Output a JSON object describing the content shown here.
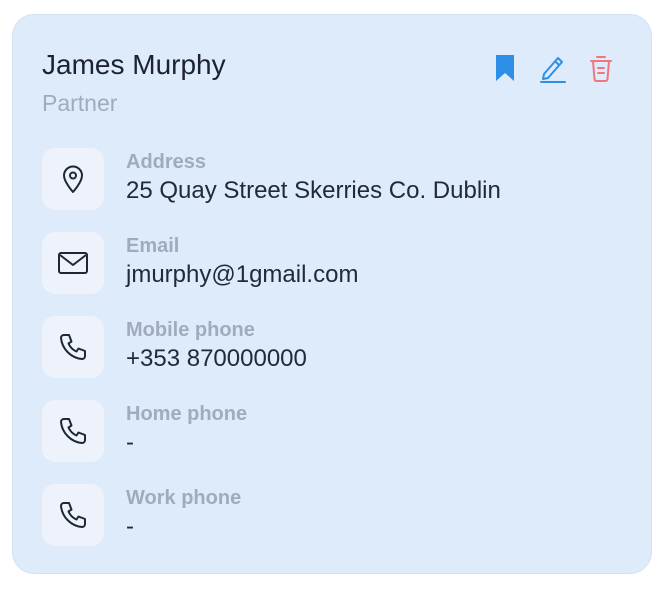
{
  "contact": {
    "name": "James Murphy",
    "role": "Partner"
  },
  "actions": [
    {
      "icon": "bookmark-icon",
      "color": "#2d8fe8"
    },
    {
      "icon": "edit-icon",
      "color": "#2d8fe8"
    },
    {
      "icon": "delete-icon",
      "color": "#f2767a"
    }
  ],
  "fields": {
    "address": {
      "label": "Address",
      "value": "25 Quay Street Skerries Co. Dublin",
      "icon": "location-pin-icon"
    },
    "email": {
      "label": "Email",
      "value": "jmurphy@1gmail.com",
      "icon": "envelope-icon"
    },
    "mobile": {
      "label": "Mobile phone",
      "value": "+353 870000000",
      "icon": "phone-icon"
    },
    "home": {
      "label": "Home phone",
      "value": "-",
      "icon": "phone-icon"
    },
    "work": {
      "label": "Work phone",
      "value": "-",
      "icon": "phone-icon"
    }
  },
  "colors": {
    "card_background": "#deebfb",
    "icon_box": "#eef3fb",
    "accent_blue": "#2d8fe8",
    "danger_red": "#f2767a"
  }
}
